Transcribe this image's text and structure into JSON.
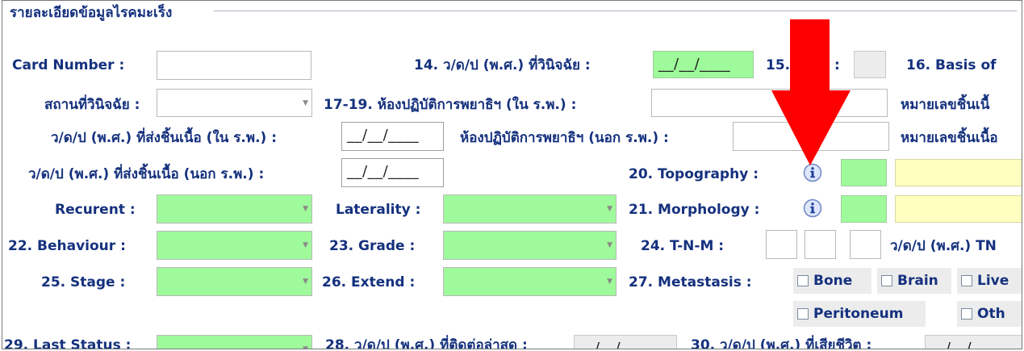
{
  "panel": {
    "title": "รายละเอียดข้อมูลไรคมะเร็ง"
  },
  "fields": {
    "card_number": {
      "label": "Card Number :",
      "value": ""
    },
    "diag_date": {
      "label": "14. ว/ด/ป (พ.ศ.) ที่วินิจฉัย :",
      "value": "__/__/____"
    },
    "field15": {
      "label": "15.",
      "colon": ":",
      "value": ""
    },
    "basis": {
      "label": "16. Basis of"
    },
    "diag_place": {
      "label": "สถานที่วินิจฉัย :",
      "value": ""
    },
    "lab_in": {
      "label": "17-19. ห้องปฏิบัติการพยาธิฯ (ใน ร.พ.) :",
      "value": ""
    },
    "specimen_no_in": {
      "label": "หมายเลขชิ้นเนื้"
    },
    "send_date_in": {
      "label": "ว/ด/ป (พ.ศ.) ที่ส่งชิ้นเนื้อ (ใน ร.พ.) :",
      "value": "__/__/____"
    },
    "lab_out": {
      "label": "ห้องปฏิบัติการพยาธิฯ (นอก ร.พ.) :",
      "value": ""
    },
    "specimen_no_out": {
      "label": "หมายเลขชิ้นเนื้อ"
    },
    "send_date_out": {
      "label": "ว/ด/ป (พ.ศ.) ที่ส่งชิ้นเนื้อ (นอก ร.พ.) :",
      "value": "__/__/____"
    },
    "topography": {
      "label": "20. Topography :",
      "code": "",
      "desc": ""
    },
    "recurrent": {
      "label": "Recurent :",
      "value": ""
    },
    "laterality": {
      "label": "Laterality :",
      "value": ""
    },
    "morphology": {
      "label": "21. Morphology :",
      "code": "",
      "desc": ""
    },
    "behaviour": {
      "label": "22. Behaviour :",
      "value": ""
    },
    "grade": {
      "label": "23. Grade :",
      "value": ""
    },
    "tnm": {
      "label": "24. T-N-M :",
      "t": "",
      "n": "",
      "m": ""
    },
    "tnm_date": {
      "label": "ว/ด/ป (พ.ศ.) TN"
    },
    "stage": {
      "label": "25. Stage :",
      "value": ""
    },
    "extend": {
      "label": "26. Extend :",
      "value": ""
    },
    "metastasis": {
      "label": "27. Metastasis :",
      "options": [
        "Bone",
        "Brain",
        "Live",
        "Peritoneum",
        "Oth"
      ]
    },
    "last_status": {
      "label": "29. Last Status :",
      "value": ""
    },
    "last_contact": {
      "label": "28. ว/ด/ป (พ.ศ.) ที่ติดต่อล่าสุด :",
      "value": "__/__/____"
    },
    "death_date": {
      "label": "30. ว/ด/ป (พ.ศ.) ที่เสียชีวิต :",
      "value": "__/__/____"
    }
  },
  "icons": {
    "info": "info-icon",
    "arrow": "red-down-arrow",
    "dropdown": "chevron-down-icon"
  },
  "colors": {
    "label": "#15317e",
    "required": "#9efa9a",
    "highlight": "#ffffc0",
    "arrow": "#ff0000"
  }
}
